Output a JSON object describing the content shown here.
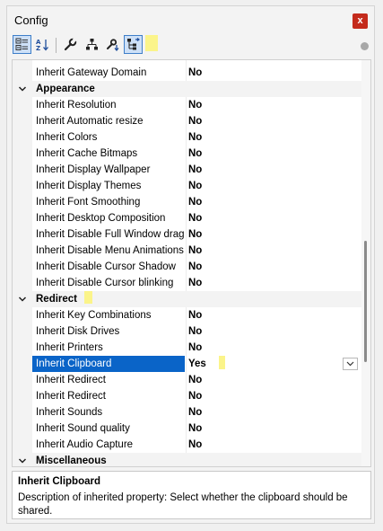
{
  "window": {
    "title": "Config",
    "close_label": "x"
  },
  "toolbar": {
    "buttons": [
      {
        "icon": "categorized-view-icon",
        "active": true
      },
      {
        "icon": "sort-alphabetical-icon",
        "active": false
      },
      {
        "icon": "wrench-icon",
        "active": false
      },
      {
        "icon": "hierarchy-icon",
        "active": false
      },
      {
        "icon": "wrench-arrow-icon",
        "active": false
      },
      {
        "icon": "inherit-hierarchy-icon",
        "active": true
      }
    ]
  },
  "grid": {
    "rows": [
      {
        "type": "property",
        "name": "Inherit Gateway Domain",
        "value": "No"
      },
      {
        "type": "category",
        "name": "Appearance",
        "expanded": true
      },
      {
        "type": "property",
        "name": "Inherit Resolution",
        "value": "No"
      },
      {
        "type": "property",
        "name": "Inherit Automatic resize",
        "value": "No"
      },
      {
        "type": "property",
        "name": "Inherit Colors",
        "value": "No"
      },
      {
        "type": "property",
        "name": "Inherit Cache Bitmaps",
        "value": "No"
      },
      {
        "type": "property",
        "name": "Inherit Display Wallpaper",
        "value": "No"
      },
      {
        "type": "property",
        "name": "Inherit Display Themes",
        "value": "No"
      },
      {
        "type": "property",
        "name": "Inherit Font Smoothing",
        "value": "No"
      },
      {
        "type": "property",
        "name": "Inherit Desktop Composition",
        "value": "No"
      },
      {
        "type": "property",
        "name": "Inherit Disable Full Window drag",
        "value": "No"
      },
      {
        "type": "property",
        "name": "Inherit Disable Menu Animations",
        "value": "No"
      },
      {
        "type": "property",
        "name": "Inherit Disable Cursor Shadow",
        "value": "No"
      },
      {
        "type": "property",
        "name": "Inherit Disable Cursor blinking",
        "value": "No"
      },
      {
        "type": "category",
        "name": "Redirect",
        "expanded": true
      },
      {
        "type": "property",
        "name": "Inherit Key Combinations",
        "value": "No"
      },
      {
        "type": "property",
        "name": "Inherit Disk Drives",
        "value": "No"
      },
      {
        "type": "property",
        "name": "Inherit Printers",
        "value": "No"
      },
      {
        "type": "property",
        "name": "Inherit Clipboard",
        "value": "Yes",
        "selected": true
      },
      {
        "type": "property",
        "name": "Inherit Redirect",
        "value": "No"
      },
      {
        "type": "property",
        "name": "Inherit Redirect",
        "value": "No"
      },
      {
        "type": "property",
        "name": "Inherit Sounds",
        "value": "No"
      },
      {
        "type": "property",
        "name": "Inherit Sound quality",
        "value": "No"
      },
      {
        "type": "property",
        "name": "Inherit Audio Capture",
        "value": "No"
      },
      {
        "type": "category",
        "name": "Miscellaneous",
        "expanded": true
      }
    ],
    "scroll_position": 0.63
  },
  "description": {
    "title": "Inherit Clipboard",
    "text": "Description of inherited property: Select whether the clipboard should be shared."
  },
  "colors": {
    "selection": "#0a64c8",
    "close": "#c42b1c",
    "toolbar_active": "#cde0f7"
  }
}
